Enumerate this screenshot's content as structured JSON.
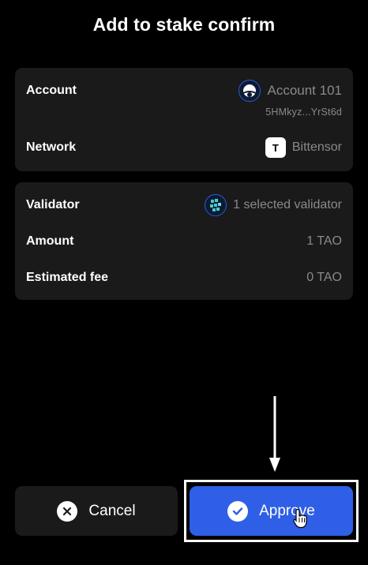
{
  "page": {
    "title": "Add to stake confirm"
  },
  "account_card": {
    "account_label": "Account",
    "account_name": "Account 101",
    "account_address": "5HMkyz...YrSt6d",
    "network_label": "Network",
    "network_icon_letter": "T",
    "network_name": "Bittensor"
  },
  "stake_card": {
    "validator_label": "Validator",
    "validator_value": "1 selected validator",
    "amount_label": "Amount",
    "amount_value": "1 TAO",
    "fee_label": "Estimated fee",
    "fee_value": "0 TAO"
  },
  "actions": {
    "cancel_label": "Cancel",
    "approve_label": "Approve"
  },
  "colors": {
    "background": "#000000",
    "card": "#1a1a1a",
    "accent": "#2f5fe6",
    "muted_text": "#8a8a8a"
  }
}
